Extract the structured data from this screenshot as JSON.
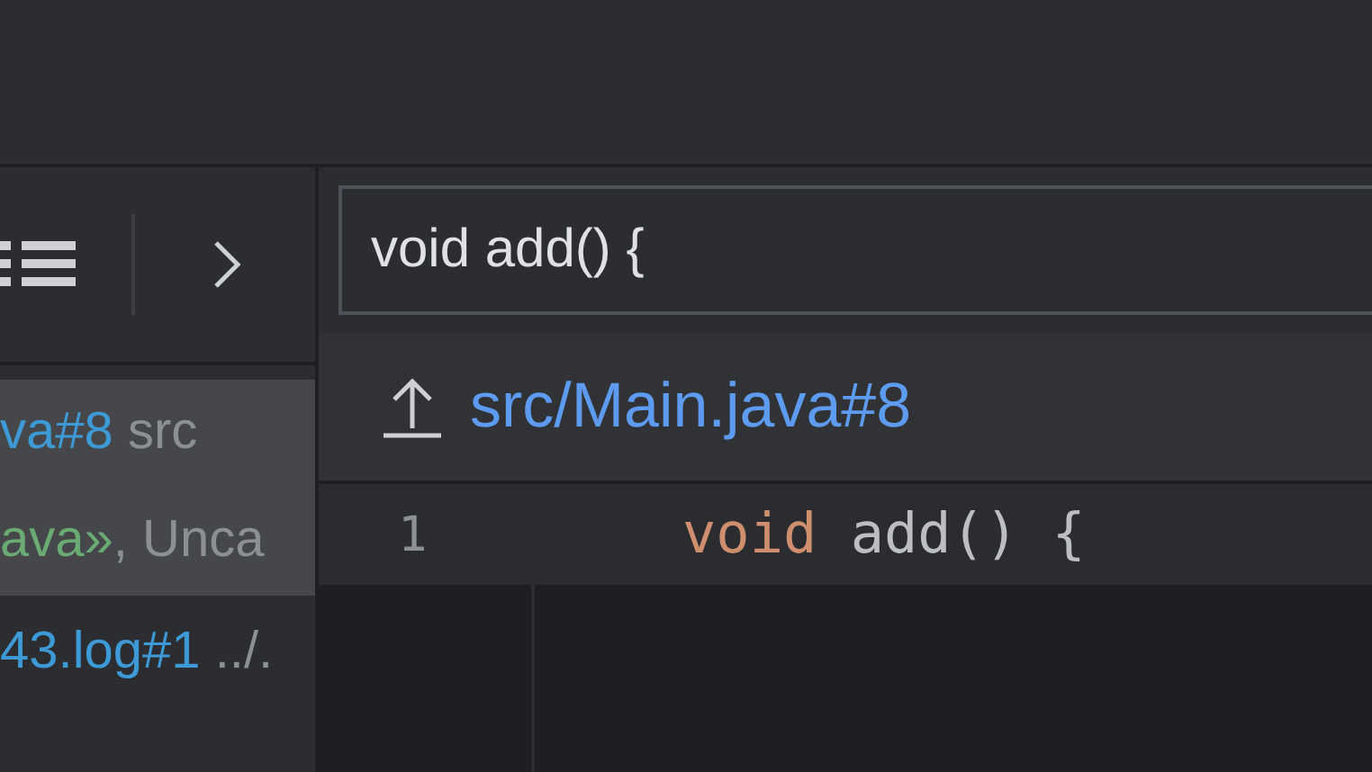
{
  "search": {
    "value": "void add() {"
  },
  "results": [
    {
      "selected": true,
      "lines": [
        [
          {
            "kind": "link",
            "text": "va#8"
          },
          {
            "kind": "plain",
            "text": " src"
          }
        ],
        [
          {
            "kind": "string",
            "text": "ava»"
          },
          {
            "kind": "plain",
            "text": ", Unca"
          }
        ]
      ]
    },
    {
      "selected": false,
      "lines": [
        [
          {
            "kind": "link",
            "text": "43.log#1"
          },
          {
            "kind": "plain",
            "text": " ../."
          }
        ]
      ]
    }
  ],
  "preview": {
    "path": "src/Main.java#8",
    "lines": [
      {
        "number": "1",
        "current": true,
        "tokens": [
          {
            "kind": "keyword",
            "text": "void"
          },
          {
            "kind": "plain",
            "text": " add() {"
          }
        ]
      }
    ]
  }
}
